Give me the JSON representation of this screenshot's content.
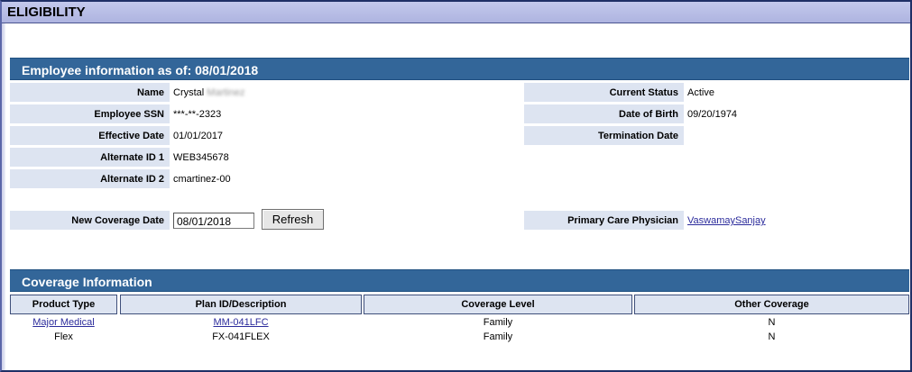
{
  "window": {
    "title": "ELIGIBILITY"
  },
  "employee_section": {
    "heading": "Employee information as of:  08/01/2018",
    "left_fields": [
      {
        "label": "Name",
        "value": "Crystal",
        "value_redacted": "Martinez"
      },
      {
        "label": "Employee SSN",
        "value": "***-**-2323"
      },
      {
        "label": "Effective Date",
        "value": "01/01/2017"
      },
      {
        "label": "Alternate ID 1",
        "value": "WEB345678"
      },
      {
        "label": "Alternate ID 2",
        "value": "cmartinez-00"
      }
    ],
    "right_fields": [
      {
        "label": "Current Status",
        "value": "Active"
      },
      {
        "label": "Date of Birth",
        "value": "09/20/1974"
      },
      {
        "label": "Termination Date",
        "value": ""
      }
    ],
    "new_coverage": {
      "label": "New Coverage Date",
      "value": "08/01/2018",
      "button": "Refresh"
    },
    "pcp": {
      "label": "Primary Care Physician",
      "value": "VaswamaySanjay"
    }
  },
  "coverage_section": {
    "heading": "Coverage Information",
    "columns": [
      "Product Type",
      "Plan ID/Description",
      "Coverage Level",
      "Other Coverage"
    ],
    "rows": [
      {
        "product": "Major Medical",
        "plan": "MM-041LFC",
        "level": "Family",
        "other": "N"
      },
      {
        "product": "Flex",
        "plan": "FX-041FLEX",
        "level": "Family",
        "other": "N"
      }
    ]
  }
}
